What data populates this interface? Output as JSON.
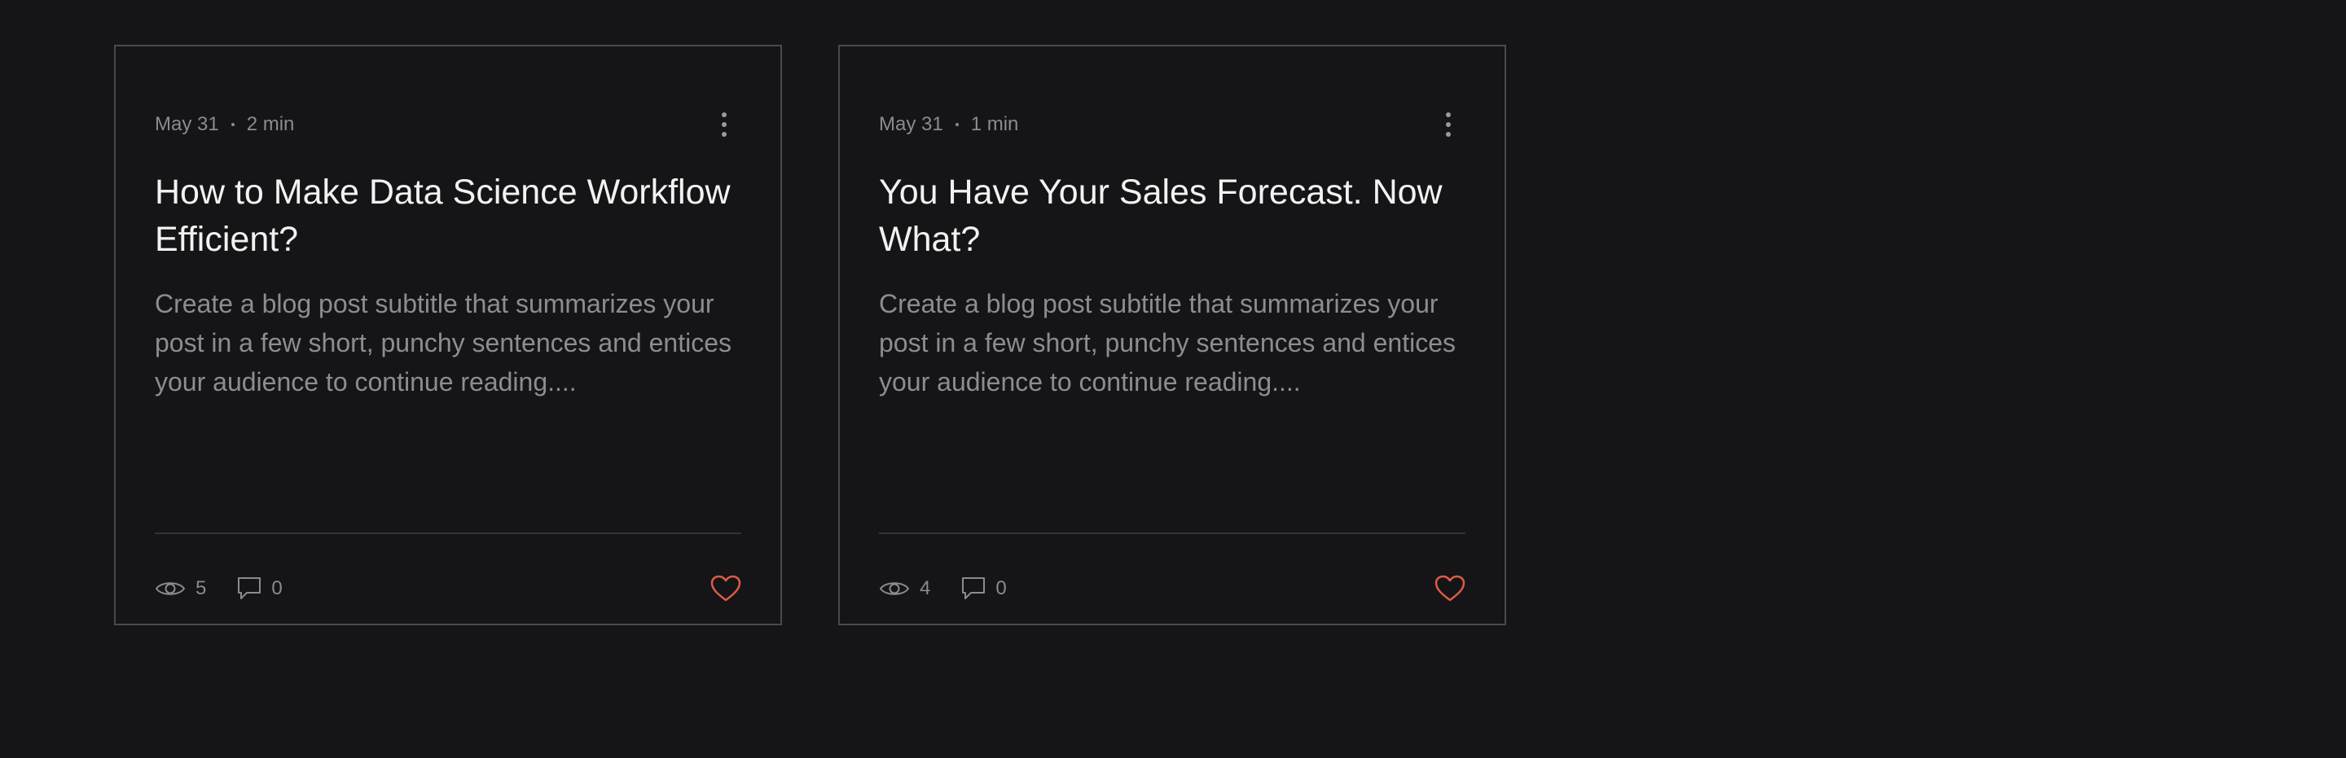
{
  "posts": [
    {
      "date": "May 31",
      "read_time": "2 min",
      "title": "How to Make Data Science Workflow Efficient?",
      "subtitle": "Create a blog post subtitle that summarizes your post in a few short, punchy sentences and entices your audience to continue reading....",
      "views": "5",
      "comments": "0",
      "liked": false
    },
    {
      "date": "May 31",
      "read_time": "1 min",
      "title": "You Have Your Sales Forecast. Now What?",
      "subtitle": "Create a blog post subtitle that summarizes your post in a few short, punchy sentences and entices your audience to continue reading....",
      "views": "4",
      "comments": "0",
      "liked": false
    }
  ],
  "icons": {
    "more": "more-vertical-icon",
    "views": "eye-icon",
    "comments": "comment-icon",
    "like": "heart-icon"
  },
  "colors": {
    "background": "#151517",
    "card_border": "#4a4a4d",
    "title": "#f2f2f2",
    "muted_text": "#8b8b8e",
    "heart": "#e05a47"
  }
}
